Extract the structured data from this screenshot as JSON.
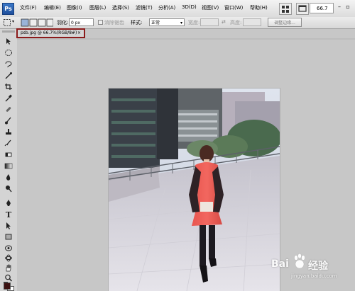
{
  "app": {
    "logo": "Ps"
  },
  "menu": [
    "文件(F)",
    "编辑(E)",
    "图像(I)",
    "图层(L)",
    "选择(S)",
    "滤镜(T)",
    "分析(A)",
    "3D(D)",
    "视图(V)",
    "窗口(W)",
    "帮助(H)"
  ],
  "zoom": "66.7",
  "options": {
    "feather_label": "羽化:",
    "feather_value": "0 px",
    "antialias_label": "消除锯齿",
    "style_label": "样式:",
    "style_value": "正常",
    "width_label": "宽度:",
    "height_label": "高度:",
    "refine_edge_label": "调整边缘..."
  },
  "document": {
    "tab_label": "psb.jpg @ 66.7%(RGB/8#)",
    "close_symbol": "×"
  },
  "watermark": {
    "brand_left": "Bai",
    "brand_right": "经验",
    "site": "jingyan.baidu.com"
  },
  "colors": {
    "tab_highlight": "#8b1a1a",
    "foreground_color": "#3b1010",
    "background_color": "#ffffff"
  }
}
